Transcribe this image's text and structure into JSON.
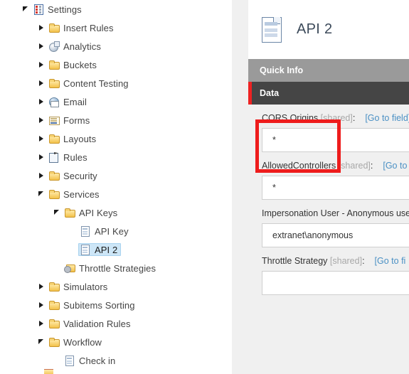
{
  "tree": {
    "items": [
      {
        "label": "Settings",
        "icon": "settings-checklist-icon",
        "indent": 0,
        "twisty": "expanded",
        "selected": false
      },
      {
        "label": "Insert Rules",
        "icon": "folder-icon",
        "indent": 1,
        "twisty": "collapsed",
        "selected": false
      },
      {
        "label": "Analytics",
        "icon": "analytics-icon",
        "indent": 1,
        "twisty": "collapsed",
        "selected": false
      },
      {
        "label": "Buckets",
        "icon": "folder-icon",
        "indent": 1,
        "twisty": "collapsed",
        "selected": false
      },
      {
        "label": "Content Testing",
        "icon": "folder-icon",
        "indent": 1,
        "twisty": "collapsed",
        "selected": false
      },
      {
        "label": "Email",
        "icon": "email-icon",
        "indent": 1,
        "twisty": "collapsed",
        "selected": false
      },
      {
        "label": "Forms",
        "icon": "forms-icon",
        "indent": 1,
        "twisty": "collapsed",
        "selected": false
      },
      {
        "label": "Layouts",
        "icon": "folder-icon",
        "indent": 1,
        "twisty": "collapsed",
        "selected": false
      },
      {
        "label": "Rules",
        "icon": "rules-icon",
        "indent": 1,
        "twisty": "collapsed",
        "selected": false
      },
      {
        "label": "Security",
        "icon": "folder-icon",
        "indent": 1,
        "twisty": "collapsed",
        "selected": false
      },
      {
        "label": "Services",
        "icon": "folder-icon",
        "indent": 1,
        "twisty": "expanded",
        "selected": false
      },
      {
        "label": "API Keys",
        "icon": "folder-icon",
        "indent": 2,
        "twisty": "expanded",
        "selected": false
      },
      {
        "label": "API Key",
        "icon": "document-icon",
        "indent": 3,
        "twisty": "none",
        "selected": false
      },
      {
        "label": "API 2",
        "icon": "document-icon",
        "indent": 3,
        "twisty": "none",
        "selected": true
      },
      {
        "label": "Throttle Strategies",
        "icon": "throttle-folder-icon",
        "indent": 2,
        "twisty": "none",
        "selected": false
      },
      {
        "label": "Simulators",
        "icon": "folder-icon",
        "indent": 1,
        "twisty": "collapsed",
        "selected": false
      },
      {
        "label": "Subitems Sorting",
        "icon": "folder-icon",
        "indent": 1,
        "twisty": "collapsed",
        "selected": false
      },
      {
        "label": "Validation Rules",
        "icon": "folder-icon",
        "indent": 1,
        "twisty": "collapsed",
        "selected": false
      },
      {
        "label": "Workflow",
        "icon": "folder-icon",
        "indent": 1,
        "twisty": "expanded",
        "selected": false
      },
      {
        "label": "Check in",
        "icon": "document-icon",
        "indent": 2,
        "twisty": "none",
        "selected": false
      }
    ]
  },
  "editor": {
    "title": "API 2",
    "sections": {
      "quick_info": "Quick Info",
      "data": "Data"
    },
    "fields": [
      {
        "label": "CORS Origins",
        "shared": "[shared]",
        "colon": ":",
        "goto": "[Go to field]",
        "value": "*",
        "highlighted": true
      },
      {
        "label": "AllowedControllers",
        "shared": "[shared]",
        "colon": ":",
        "goto": "[Go to",
        "value": "*",
        "highlighted": false
      },
      {
        "label": "Impersonation User - Anonymous use",
        "shared": "",
        "colon": "",
        "goto": "",
        "value": "extranet\\anonymous",
        "highlighted": false
      },
      {
        "label": "Throttle Strategy",
        "shared": "[shared]",
        "colon": ":",
        "goto": "[Go to fi",
        "value": "",
        "highlighted": false
      }
    ]
  },
  "colors": {
    "selection_blue": "#cde6f7",
    "data_section_bg": "#454545",
    "quick_info_bg": "#9a9a9a",
    "accent_red": "#ee2222",
    "annotation_red": "#ee1c1c",
    "link_blue": "#4a90c4",
    "panel_gray": "#f0f0f0",
    "scrollbar_thumb": "#c0c0c0"
  }
}
